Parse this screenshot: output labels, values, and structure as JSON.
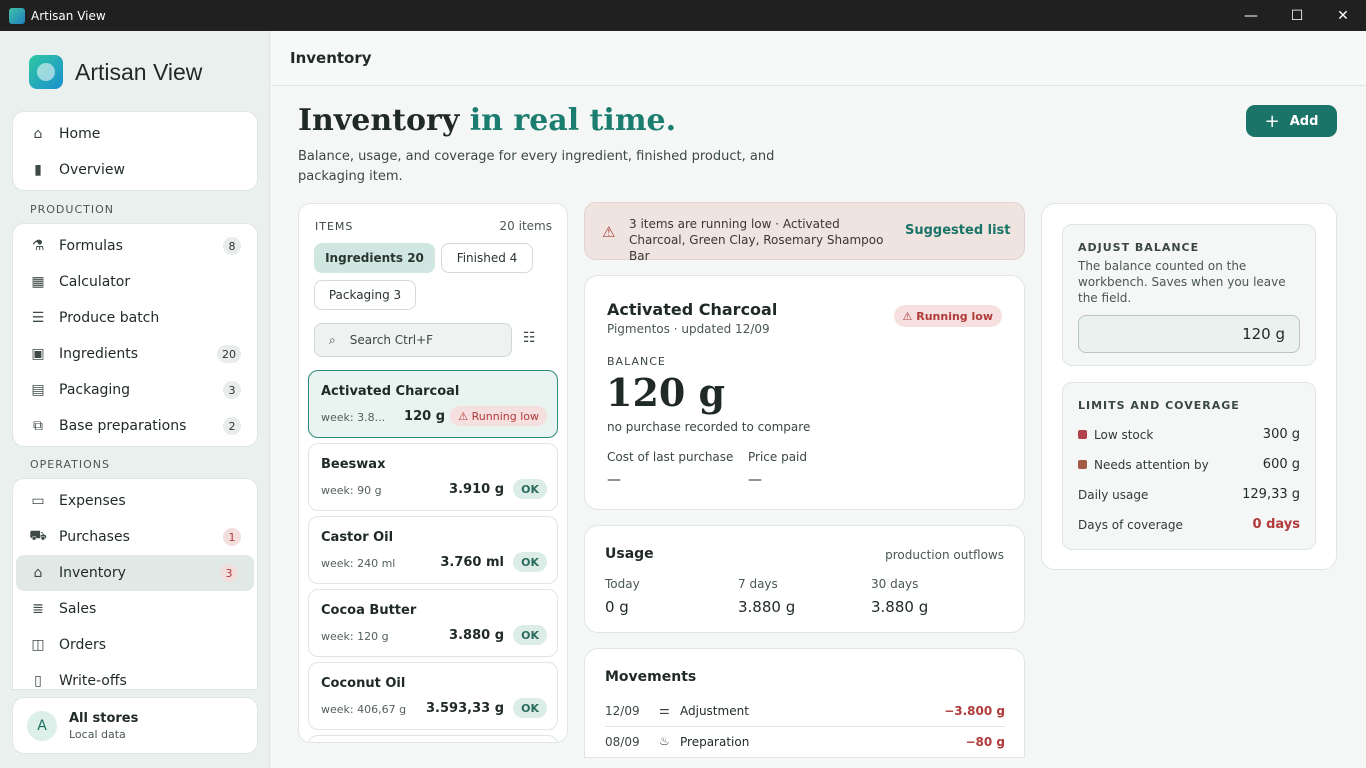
{
  "window": {
    "title": "Artisan View",
    "controls": [
      "—",
      "☐",
      "✕"
    ]
  },
  "brand": {
    "name": "Artisan View"
  },
  "nav": {
    "top": [
      {
        "label": "Home",
        "icon": "home-icon"
      },
      {
        "label": "Overview",
        "icon": "bar-chart-icon"
      }
    ],
    "production_title": "PRODUCTION",
    "production": [
      {
        "label": "Formulas",
        "badge": "8"
      },
      {
        "label": "Calculator",
        "badge": ""
      },
      {
        "label": "Produce batch",
        "badge": ""
      },
      {
        "label": "Ingredients",
        "badge": "20"
      },
      {
        "label": "Packaging",
        "badge": "3"
      },
      {
        "label": "Base preparations",
        "badge": "2"
      }
    ],
    "operations_title": "OPERATIONS",
    "operations": [
      {
        "label": "Expenses",
        "badge": ""
      },
      {
        "label": "Purchases",
        "badge": "1"
      },
      {
        "label": "Inventory",
        "badge": "3"
      },
      {
        "label": "Sales",
        "badge": ""
      },
      {
        "label": "Orders",
        "badge": ""
      },
      {
        "label": "Write-offs",
        "badge": ""
      }
    ],
    "store": {
      "avatar": "A",
      "name": "All stores",
      "sub": "Local data"
    }
  },
  "page": {
    "topbar_title": "Inventory",
    "hero_title": "Inventory ",
    "hero_accent": "in real time.",
    "hero_sub": "Balance, usage, and coverage for every ingredient, finished product, and packaging item.",
    "add_label": "Add"
  },
  "items": {
    "heading": "ITEMS",
    "count": "20 items",
    "chips": [
      "Ingredients 20",
      "Finished 4",
      "Packaging 3"
    ],
    "search_placeholder": "Search  Ctrl+F",
    "list": [
      {
        "name": "Activated Charcoal",
        "week": "week: 3.8...",
        "balance": "120 g",
        "status": "Running low"
      },
      {
        "name": "Beeswax",
        "week": "week: 90 g",
        "balance": "3.910 g",
        "status": "OK"
      },
      {
        "name": "Castor Oil",
        "week": "week: 240 ml",
        "balance": "3.760 ml",
        "status": "OK"
      },
      {
        "name": "Cocoa Butter",
        "week": "week: 120 g",
        "balance": "3.880 g",
        "status": "OK"
      },
      {
        "name": "Coconut Oil",
        "week": "week: 406,67 g",
        "balance": "3.593,33 g",
        "status": "OK"
      }
    ]
  },
  "alert": {
    "text": "3 items are running low · Activated Charcoal, Green Clay, Rosemary Shampoo Bar",
    "link": "Suggested list"
  },
  "detail": {
    "name": "Activated Charcoal",
    "sub": "Pigmentos · updated 12/09",
    "badge": "Running low",
    "balance_label": "BALANCE",
    "balance": "120 g",
    "note": "no purchase recorded to compare",
    "cost_label": "Cost of last purchase",
    "cost_value": "—",
    "price_label": "Price paid",
    "price_value": "—"
  },
  "usage": {
    "title": "Usage",
    "note": "production outflows",
    "cols": [
      {
        "label": "Today",
        "value": "0 g"
      },
      {
        "label": "7 days",
        "value": "3.880 g"
      },
      {
        "label": "30 days",
        "value": "3.880 g"
      }
    ]
  },
  "movements": {
    "title": "Movements",
    "rows": [
      {
        "date": "12/09",
        "type": "Adjustment",
        "amount": "−3.800 g"
      },
      {
        "date": "08/09",
        "type": "Preparation",
        "amount": "−80 g"
      }
    ]
  },
  "adjust": {
    "heading": "ADJUST BALANCE",
    "desc": "The balance counted on the workbench. Saves when you leave the field.",
    "value": "120 g"
  },
  "limits": {
    "heading": "LIMITS AND COVERAGE",
    "rows": [
      {
        "label": "Low stock",
        "value": "300 g",
        "dot": "#b2434b"
      },
      {
        "label": "Needs attention by",
        "value": "600 g",
        "dot": "#a35a45"
      },
      {
        "label": "Daily usage",
        "value": "129,33 g",
        "dot": ""
      },
      {
        "label": "Days of coverage",
        "value": "0 days",
        "dot": ""
      }
    ]
  },
  "colors": {
    "accent": "#1a7468",
    "danger": "#b03a3a"
  }
}
